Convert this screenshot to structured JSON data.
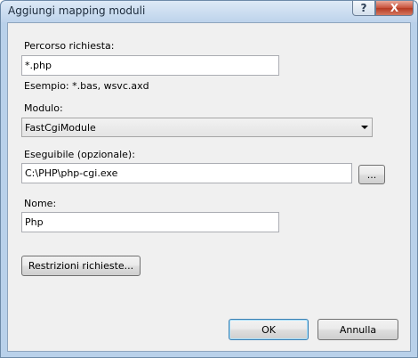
{
  "window": {
    "title": "Aggiungi mapping moduli",
    "help_glyph": "?",
    "close_glyph": "X"
  },
  "form": {
    "path": {
      "label": "Percorso richiesta:",
      "value": "*.php",
      "example": "Esempio: *.bas, wsvc.axd"
    },
    "module": {
      "label": "Modulo:",
      "selected": "FastCgiModule"
    },
    "executable": {
      "label": "Eseguibile (opzionale):",
      "value": "C:\\PHP\\php-cgi.exe",
      "browse_label": "..."
    },
    "name": {
      "label": "Nome:",
      "value": "Php"
    },
    "restrictions_label": "Restrizioni richieste..."
  },
  "buttons": {
    "ok": "OK",
    "cancel": "Annulla"
  }
}
